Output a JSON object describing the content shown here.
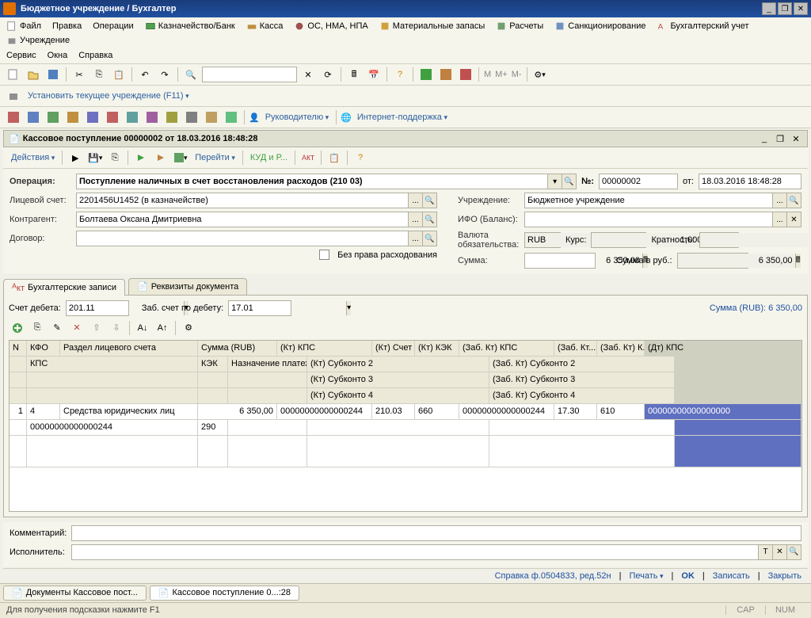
{
  "app_title": "Бюджетное учреждение / Бухгалтер",
  "menus": {
    "row1": [
      "Файл",
      "Правка",
      "Операции",
      "Казначейство/Банк",
      "Касса",
      "ОС, НМА, НПА",
      "Материальные запасы",
      "Расчеты",
      "Санкционирование",
      "Бухгалтерский учет",
      "Учреждение"
    ],
    "row2": [
      "Сервис",
      "Окна",
      "Справка"
    ]
  },
  "toolbar1": {
    "set_institution": "Установить текущее учреждение (F11)"
  },
  "toolbar2": {
    "leader": "Руководителю",
    "support": "Интернет-поддержка"
  },
  "doc": {
    "title": "Кассовое поступление 00000002 от 18.03.2016 18:48:28",
    "actions": "Действия",
    "goto": "Перейти",
    "kudir": "КУД и Р...",
    "op_label": "Операция:",
    "operation": "Поступление наличных в счет восстановления расходов (210 03)",
    "num_label": "№:",
    "number": "00000002",
    "date_label": "от:",
    "date": "18.03.2016 18:48:28",
    "ls_label": "Лицевой счет:",
    "ls": "2201456U1452 (в казначействе)",
    "kontr_label": "Контрагент:",
    "kontr": "Болтаева Оксана Дмитриевна",
    "dogovor_label": "Договор:",
    "dogovor": "",
    "nopravo": "Без права расходования",
    "uchr_label": "Учреждение:",
    "uchr": "Бюджетное учреждение",
    "ifo_label": "ИФО (Баланс):",
    "ifo": "",
    "valuta_label": "Валюта обязательства:",
    "valuta": "RUB",
    "kurs_label": "Курс:",
    "kurs": "1,0000",
    "kratnost_label": "Кратность:",
    "kratnost": "1",
    "summa_label": "Сумма:",
    "summa": "6 350,00",
    "summa_rub_label": "Сумма в руб.:",
    "summa_rub": "6 350,00"
  },
  "tabs": {
    "t1": "Бухгалтерские записи",
    "t2": "Реквизиты документа"
  },
  "accounts": {
    "debet_label": "Счет дебета:",
    "debet": "201.11",
    "zab_label": "Заб. счет по дебету:",
    "zab": "17.01",
    "sum_label": "Сумма (RUB): 6 350,00"
  },
  "grid": {
    "headers1": {
      "n": "N",
      "kfo": "КФО",
      "razdel": "Раздел лицевого счета",
      "sum": "Сумма (RUB)",
      "ktkps": "(Кт) КПС",
      "ktschet": "(Кт) Счет",
      "ktkek": "(Кт) КЭК",
      "zabktkps": "(Заб. Кт) КПС",
      "zabkt": "(Заб. Кт...",
      "zabktk": "(Заб. Кт) К...",
      "dtkps": "(Дт) КПС"
    },
    "headers2": {
      "kps": "КПС",
      "kek": "КЭК",
      "nazn": "Назначение платежа",
      "ktsub2": "(Кт) Субконто 2",
      "zabktsub2": "(Заб. Кт) Субконто 2"
    },
    "headers3": {
      "ktsub3": "(Кт) Субконто 3",
      "zabktsub3": "(Заб. Кт) Субконто 3"
    },
    "headers4": {
      "ktsub4": "(Кт) Субконто 4",
      "zabktsub4": "(Заб. Кт) Субконто 4"
    },
    "row": {
      "n": "1",
      "kfo": "4",
      "razdel": "Средства юридических лиц",
      "sum": "6 350,00",
      "ktkps": "00000000000000244",
      "ktschet": "210.03",
      "ktkek": "660",
      "zabktkps": "00000000000000244",
      "zabkt": "17.30",
      "zabktk": "610",
      "dtkps": "00000000000000000",
      "kps": "00000000000000244",
      "kek": "290"
    }
  },
  "bottom": {
    "comment_label": "Комментарий:",
    "executor_label": "Исполнитель:"
  },
  "footer": {
    "spravka": "Справка ф.0504833, ред.52н",
    "print": "Печать",
    "ok": "OK",
    "save": "Записать",
    "close": "Закрыть"
  },
  "wintabs": {
    "t1": "Документы Кассовое пост...",
    "t2": "Кассовое поступление 0...:28"
  },
  "status": {
    "hint": "Для получения подсказки нажмите F1",
    "cap": "CAP",
    "num": "NUM"
  }
}
